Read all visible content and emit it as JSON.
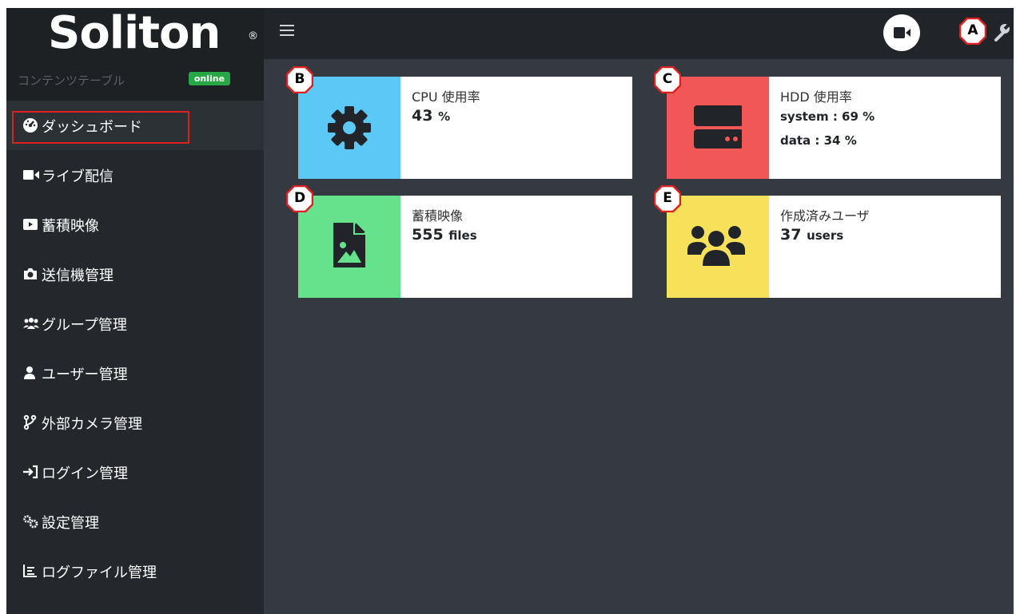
{
  "brand": {
    "logo_text": "Soliton",
    "registered": "®"
  },
  "sidebar": {
    "content_label": "コンテンツテーブル",
    "status_badge": "online",
    "items": [
      {
        "label": "ダッシュボード",
        "icon": "dashboard-gauge-icon"
      },
      {
        "label": "ライブ配信",
        "icon": "video-camera-icon"
      },
      {
        "label": "蓄積映像",
        "icon": "video-player-icon"
      },
      {
        "label": "送信機管理",
        "icon": "camera-icon"
      },
      {
        "label": "グループ管理",
        "icon": "users-group-icon"
      },
      {
        "label": "ユーザー管理",
        "icon": "user-icon"
      },
      {
        "label": "外部カメラ管理",
        "icon": "branch-icon"
      },
      {
        "label": "ログイン管理",
        "icon": "sign-in-icon"
      },
      {
        "label": "設定管理",
        "icon": "gears-icon"
      },
      {
        "label": "ログファイル管理",
        "icon": "list-chart-icon"
      }
    ]
  },
  "cards": {
    "cpu": {
      "title": "CPU 使用率",
      "value": "43",
      "unit": "%",
      "color": "#5bc8f5",
      "icon": "gear-icon"
    },
    "hdd": {
      "title": "HDD 使用率",
      "line1": "system : 69 %",
      "line2": "data : 34 %",
      "color": "#f25757",
      "icon": "hard-drive-icon"
    },
    "videos": {
      "title": "蓄積映像",
      "value": "555",
      "unit": "files",
      "color": "#66e28c",
      "icon": "image-file-icon"
    },
    "users": {
      "title": "作成済みユーザ",
      "value": "37",
      "unit": "users",
      "color": "#f7e05a",
      "icon": "users-icon"
    }
  },
  "callouts": {
    "a": "A",
    "b": "B",
    "c": "C",
    "d": "D",
    "e": "E"
  },
  "colors": {
    "sidebar": "#24282c",
    "main": "#343a40",
    "topbar": "#212529",
    "online": "#28a745",
    "highlight": "#e02020"
  }
}
